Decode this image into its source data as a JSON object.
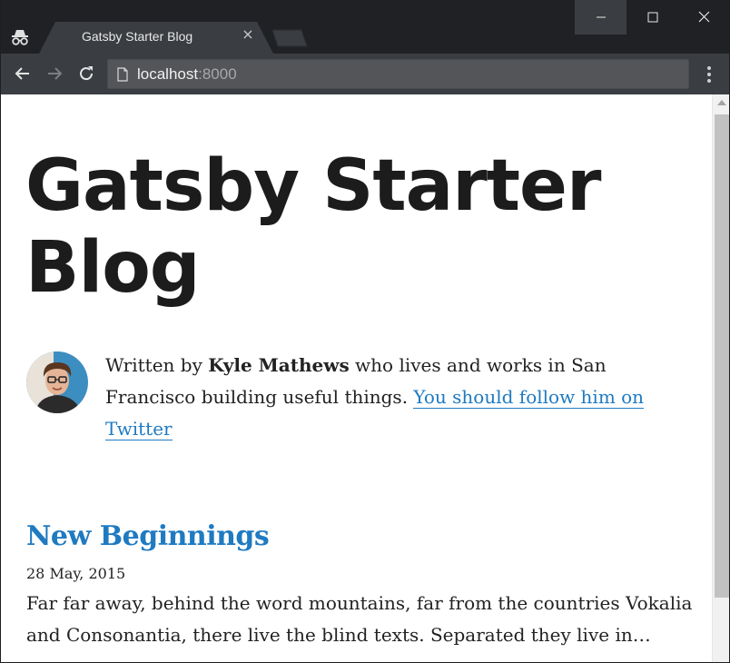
{
  "browser": {
    "tab_title": "Gatsby Starter Blog",
    "tab_close_glyph": "×",
    "url_host": "localhost",
    "url_port": ":8000",
    "icons": [
      "incognito-icon",
      "close-icon",
      "minimize-icon",
      "maximize-icon",
      "back-arrow-icon",
      "forward-arrow-icon",
      "reload-icon",
      "page-icon",
      "kebab-menu-icon"
    ],
    "colors": {
      "tabstrip": "#202124",
      "toolbar": "#3a3d41",
      "omnibox": "#535558"
    }
  },
  "page": {
    "site_title": "Gatsby Starter Blog",
    "bio": {
      "prefix": "Written by ",
      "author": "Kyle Mathews",
      "middle": " who lives and works in San Francisco building useful things. ",
      "link_text": "You should follow him on Twitter"
    },
    "posts": [
      {
        "title": "New Beginnings",
        "date": "28 May, 2015",
        "excerpt": "Far far away, behind the word mountains, far from the countries Vokalia and Consonantia, there live the blind texts. Separated they live in…"
      }
    ],
    "colors": {
      "link": "#1f7ac1",
      "title": "#1c1c1c",
      "text": "#222222"
    }
  }
}
